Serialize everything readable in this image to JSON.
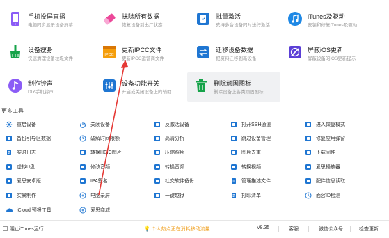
{
  "tiles": [
    {
      "id": "mirror",
      "title": "手机投屏直播",
      "subtitle": "电脑同步显示设备屏幕",
      "icon": "screen-mirror-icon",
      "color": "#8b5cf6",
      "highlight": false
    },
    {
      "id": "erase",
      "title": "抹除所有数据",
      "subtitle": "恢复设备到出厂状态",
      "icon": "eraser-icon",
      "color": "#ec4899",
      "highlight": false
    },
    {
      "id": "activate",
      "title": "批量激活",
      "subtitle": "支持多台设备同时进行激活",
      "icon": "phone-activate-icon",
      "color": "#1f76d2",
      "highlight": false
    },
    {
      "id": "itunes",
      "title": "iTunes及驱动",
      "subtitle": "安装和修复iTunes及驱动",
      "icon": "music-note-icon",
      "color": "#1e88e5",
      "highlight": false
    },
    {
      "id": "slim",
      "title": "设备瘦身",
      "subtitle": "快速清理设备垃圾文件",
      "icon": "broom-icon",
      "color": "#16a34a",
      "highlight": false
    },
    {
      "id": "ipcc",
      "title": "更新IPCC文件",
      "subtitle": "更新IPCC运营商文件",
      "icon": "ipcc-file-icon",
      "color": "#f59e0b",
      "highlight": false
    },
    {
      "id": "migrate",
      "title": "迁移设备数据",
      "subtitle": "把资料迁移到新设备",
      "icon": "migrate-icon",
      "color": "#1f76d2",
      "highlight": false
    },
    {
      "id": "blockupdate",
      "title": "屏蔽iOS更新",
      "subtitle": "屏蔽设备的iOS更新提示",
      "icon": "block-update-icon",
      "color": "#5b3fd6",
      "highlight": false
    },
    {
      "id": "ringtone",
      "title": "制作铃声",
      "subtitle": "DIY手机铃声",
      "icon": "music-ring-icon",
      "color": "#8b5cf6",
      "highlight": false
    },
    {
      "id": "functions",
      "title": "设备功能开关",
      "subtitle": "开启或关闭设备上的辅助...",
      "icon": "switch-sliders-icon",
      "color": "#1f76d2",
      "highlight": false
    },
    {
      "id": "deleteicons",
      "title": "删除顽固图标",
      "subtitle": "删除设备上各类顽固图标",
      "icon": "trash-icon",
      "color": "#16a34a",
      "highlight": true
    }
  ],
  "section_title": "更多工具",
  "tools": [
    [
      "重启设备",
      "关闭设备",
      "反激活设备",
      "打开SSH通道",
      "进入恢复模式"
    ],
    [
      "备份引导区数据",
      "破解时间限额",
      "高清分析",
      "跳过设备管理",
      "修复应用弹窗"
    ],
    [
      "实时日志",
      "转换HEIC图片",
      "压缩照片",
      "图片去重",
      "下载固件"
    ],
    [
      "虚拟U盘",
      "修改音频",
      "转换音频",
      "转换视频",
      "爱思播放器"
    ],
    [
      "爱思安卓版",
      "IPA签名",
      "社交软件备份",
      "管理描述文件",
      "配件信息读取"
    ],
    [
      "实景制作",
      "电脑录屏",
      "一键越狱",
      "打印清单",
      "面容ID检测"
    ],
    [
      "iCloud 预报工具",
      "爱思商城"
    ]
  ],
  "tool_icons": [
    [
      "sun-icon",
      "power-icon",
      "unlink-icon",
      "terminal-icon",
      "mobile-recovery-icon"
    ],
    [
      "backup-icon",
      "clock-icon",
      "hd-analysis-icon",
      "skip-icon",
      "repair-icon"
    ],
    [
      "log-icon",
      "heic-icon",
      "compress-photo-icon",
      "dedupe-icon",
      "download-firmware-icon"
    ],
    [
      "usb-icon",
      "audio-edit-icon",
      "audio-convert-icon",
      "video-convert-icon",
      "player-icon"
    ],
    [
      "android-icon",
      "ipa-sign-icon",
      "social-backup-icon",
      "profile-icon",
      "accessory-icon"
    ],
    [
      "live-photo-icon",
      "screen-record-icon",
      "jailbreak-icon",
      "print-icon",
      "face-id-icon"
    ],
    [
      "cloud-icon",
      "store-icon"
    ]
  ],
  "status": {
    "block_itunes": "阻止iTunes运行",
    "notice": "个人热点正在消耗移动流量",
    "version": "V8.35",
    "feedback": "客服",
    "wechat": "微信公众号",
    "update": "检查更新"
  },
  "colors": {
    "accent": "#1f76d2",
    "arrow": "#e53935",
    "notice": "#f0a020"
  }
}
